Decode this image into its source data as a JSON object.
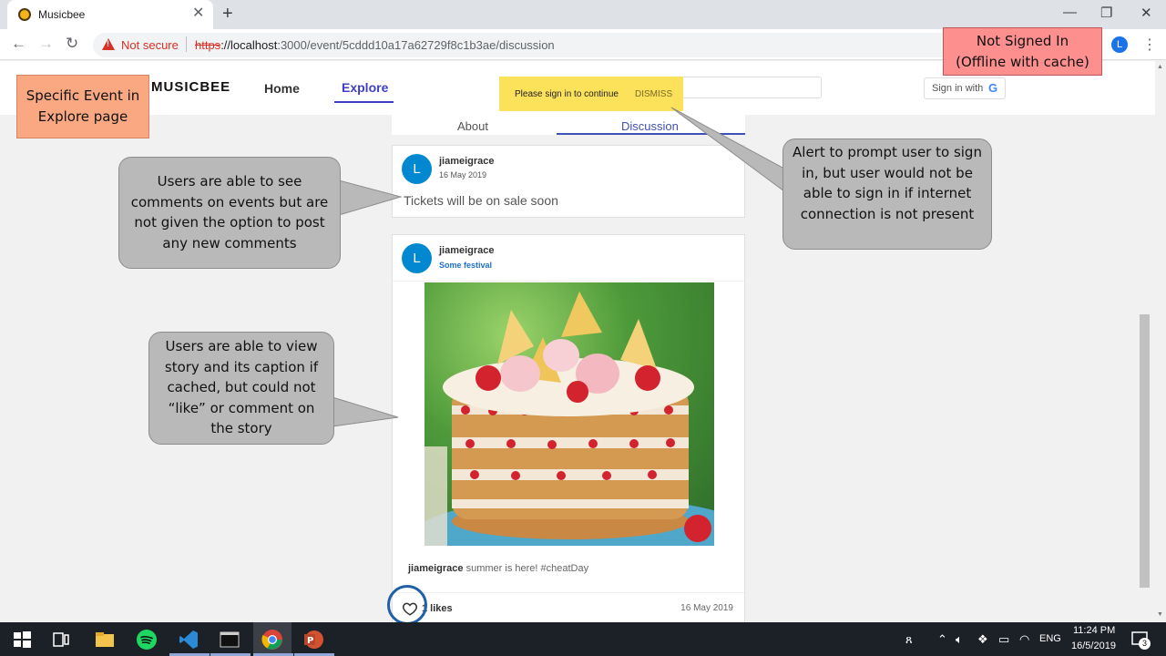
{
  "browser": {
    "tab_title": "Musicbee",
    "tab_close": "✕",
    "new_tab": "+",
    "minimize": "—",
    "restore": "❐",
    "close": "✕",
    "not_secure": "Not secure",
    "url_scheme": "https",
    "url_host": "://localhost",
    "url_path": ":3000/event/5cddd10a17a62729f8c1b3ae/discussion",
    "profile_initial": "L"
  },
  "app": {
    "logo": "MUSICBEE",
    "nav": {
      "home": "Home",
      "explore": "Explore"
    },
    "signin_label": "Sign in with",
    "google_letter": "G",
    "tabs": {
      "about": "About",
      "discussion": "Discussion"
    },
    "alert": {
      "message": "Please sign in to continue",
      "dismiss": "DISMISS"
    }
  },
  "comment": {
    "avatar": "L",
    "user": "jiameigrace",
    "date": "16 May 2019",
    "text": "Tickets will be on sale soon"
  },
  "story": {
    "avatar": "L",
    "user": "jiameigrace",
    "event": "Some festival",
    "caption_user": "jiameigrace",
    "caption_text": "summer is here! #cheatDay",
    "likes": "1 likes",
    "date": "16 May 2019"
  },
  "annotations": {
    "page_label_line1": "Specific Event in",
    "page_label_line2": "Explore page",
    "state_line1": "Not Signed In",
    "state_line2": "(Offline with cache)",
    "comments_note": "Users are able to see comments on events but are not given the option to post any new comments",
    "story_note": "Users are able to view story and its caption if cached, but could not “like” or comment on the story",
    "alert_note": "Alert to prompt user to sign in, but user would not be able to sign in if internet connection is not present"
  },
  "taskbar": {
    "time": "11:24 PM",
    "date": "16/5/2019",
    "lang": "ENG",
    "notification_count": "3"
  },
  "colors": {
    "accent": "#3f3fc7",
    "avatar": "#0288d1",
    "alert": "#fce15a",
    "note_orange": "#f9a882",
    "note_red": "#fe8f8f",
    "bubble": "#b9b9b9"
  }
}
